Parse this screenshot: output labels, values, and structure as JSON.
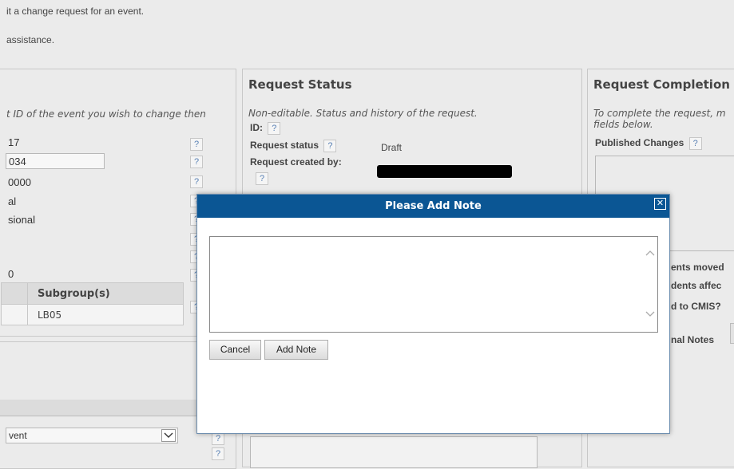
{
  "intro": {
    "line1": "it a change request for an event.",
    "line2": "assistance."
  },
  "left_panel": {
    "instructions": "t ID of the event you wish to change then",
    "values": [
      "17",
      "034",
      "0000",
      "al",
      "sional",
      "0"
    ],
    "table": {
      "header": "Subgroup(s)",
      "cell": "LB05"
    },
    "dropdown_value": "vent"
  },
  "request_status": {
    "title": "Request Status",
    "description": "Non-editable. Status and history of the request.",
    "id_label": "ID:",
    "status_label": "Request status",
    "status_value": "Draft",
    "created_by_label": "Request created by:"
  },
  "request_completion": {
    "title": "Request Completion",
    "description_line1": "To complete the request, m",
    "description_line2": "fields below.",
    "published_label": "Published Changes",
    "label_students_moved": "ents moved",
    "label_students_affected": "dents affec",
    "label_cmis": "d to CMIS?",
    "label_notes": "nal Notes"
  },
  "help_glyph": "?",
  "dialog": {
    "title": "Please Add Note",
    "close_glyph": "✕",
    "note_value": "",
    "cancel_label": "Cancel",
    "add_note_label": "Add Note"
  },
  "icons": {
    "scroll_up": "chevron-up-icon",
    "scroll_down": "chevron-down-icon",
    "close": "close-icon",
    "help": "help-icon"
  }
}
